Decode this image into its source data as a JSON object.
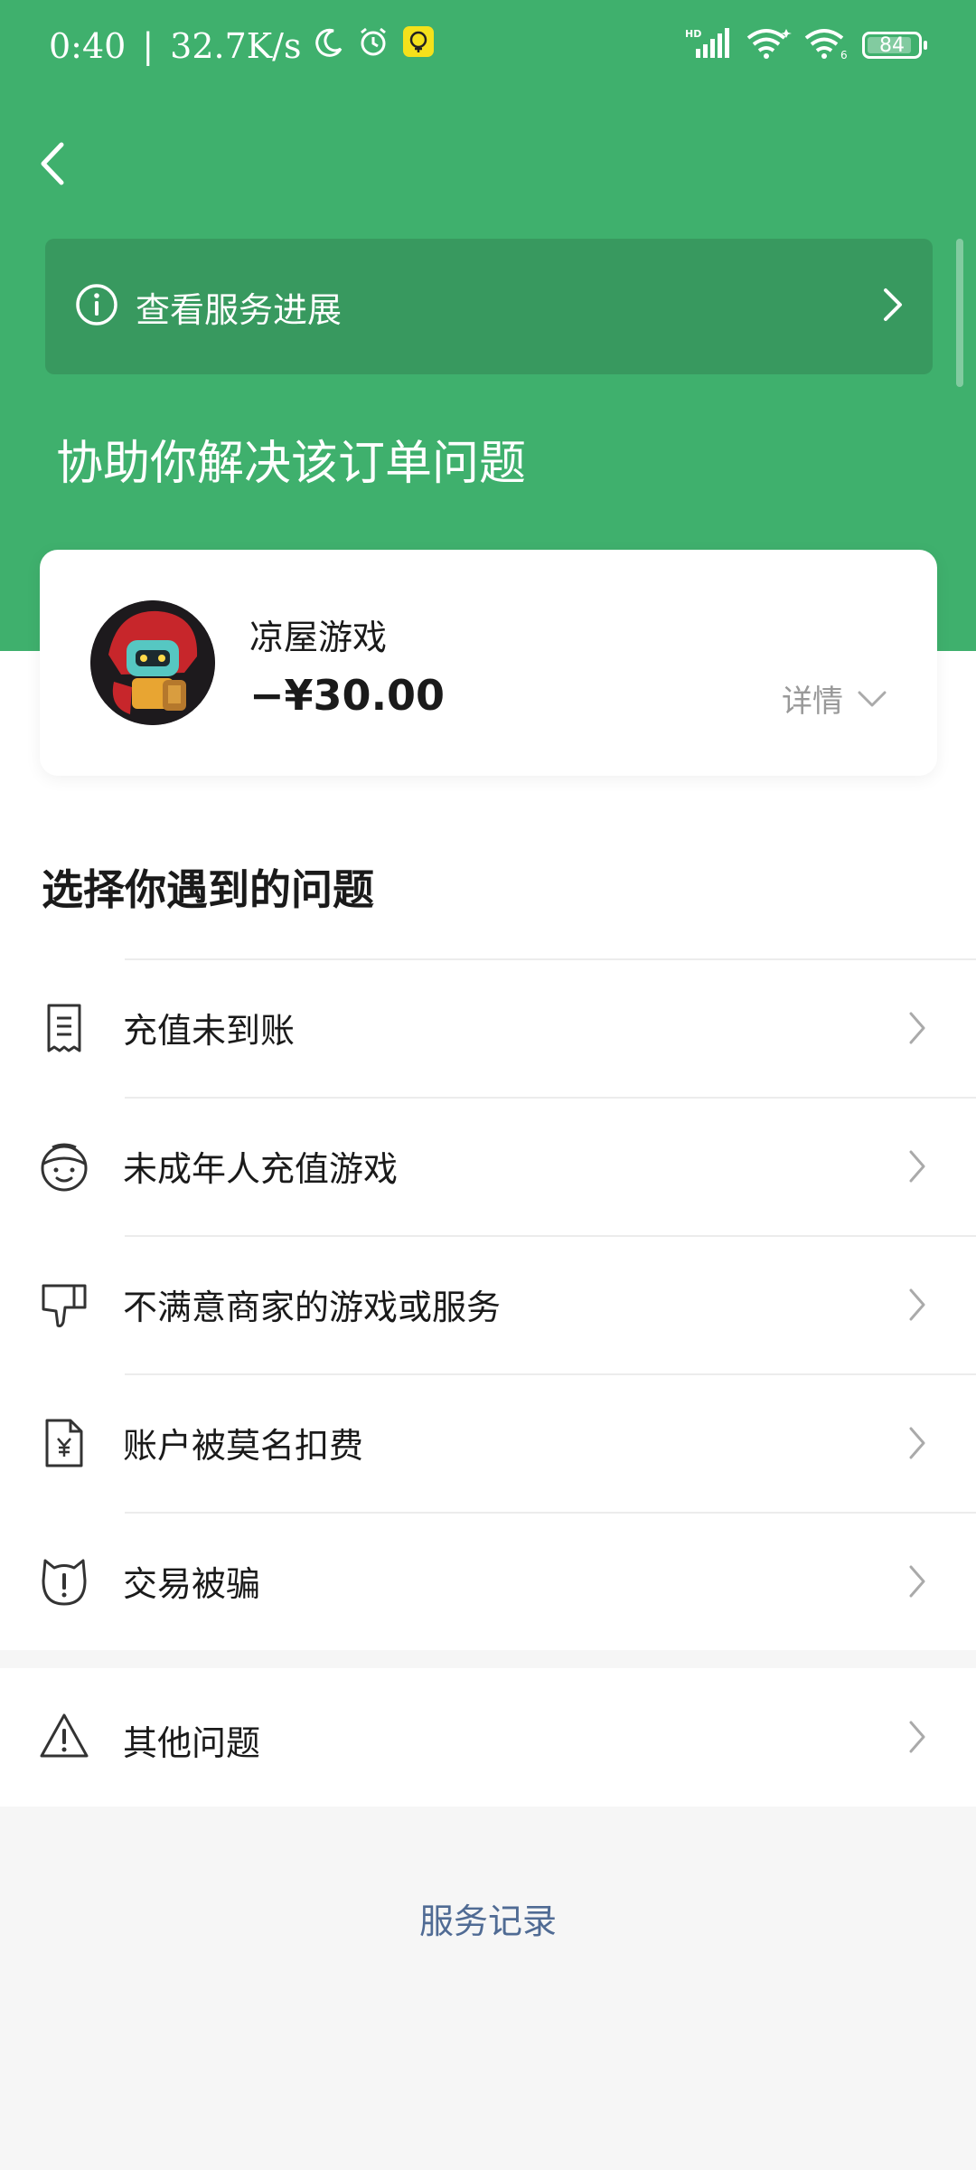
{
  "status_bar": {
    "time": "0:40",
    "separator": "|",
    "speed": "32.7K/s",
    "battery": "84",
    "icons": [
      "moon-icon",
      "alarm-icon",
      "app-notification-icon",
      "signal-hd-icon",
      "wifi-icon",
      "wifi-6-icon",
      "battery-icon"
    ]
  },
  "header": {
    "progress_banner": "查看服务进展",
    "title": "协助你解决该订单问题"
  },
  "order": {
    "merchant": "凉屋游戏",
    "amount": "−¥30.00",
    "details_label": "详情"
  },
  "issues": {
    "section_title": "选择你遇到的问题",
    "items": [
      {
        "label": "充值未到账",
        "icon": "receipt-icon"
      },
      {
        "label": "未成年人充值游戏",
        "icon": "child-face-icon"
      },
      {
        "label": "不满意商家的游戏或服务",
        "icon": "thumbs-down-icon"
      },
      {
        "label": "账户被莫名扣费",
        "icon": "yen-document-icon"
      },
      {
        "label": "交易被骗",
        "icon": "alert-cat-icon"
      }
    ],
    "other": {
      "label": "其他问题",
      "icon": "warning-triangle-icon"
    }
  },
  "footer": {
    "service_record": "服务记录"
  },
  "colors": {
    "primary_green": "#3fb06d",
    "banner_green": "#38995f",
    "link_blue": "#506b94"
  }
}
